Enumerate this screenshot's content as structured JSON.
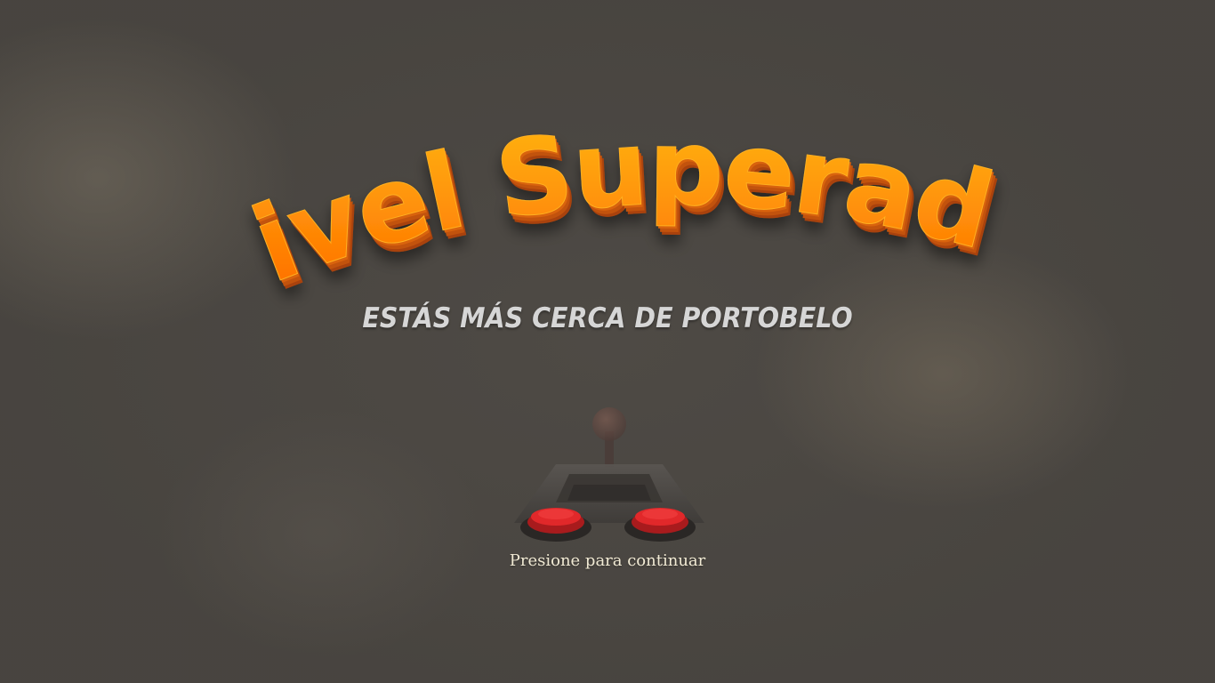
{
  "screen": {
    "title": "¡Nivel Superado!",
    "subtitle": "ESTÁS MÁS CERCA DE PORTOBELO",
    "prompt": "Presione para continuar"
  },
  "colors": {
    "background": "#4e4a45",
    "title_top": "#ffd21a",
    "title_bottom": "#ff7a00",
    "title_extrude": "#b84a00",
    "subtitle": "#d6d6d6",
    "button_red": "#e1282a",
    "prompt": "#f1ead4"
  },
  "icons": {
    "controller": "arcade-joystick-icon"
  }
}
